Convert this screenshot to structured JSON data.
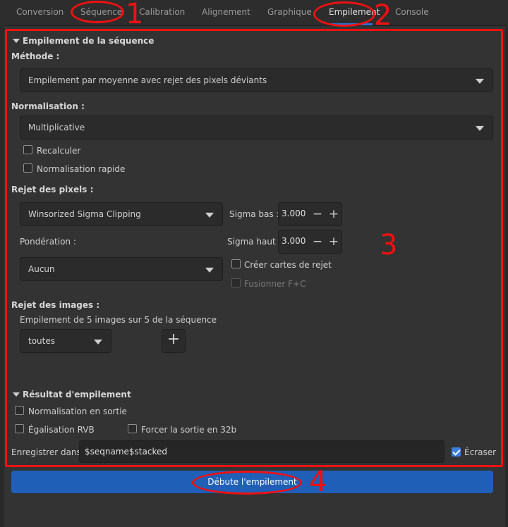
{
  "tabs": [
    {
      "label": "Conversion"
    },
    {
      "label": "Séquence"
    },
    {
      "label": "Calibration"
    },
    {
      "label": "Alignement"
    },
    {
      "label": "Graphique"
    },
    {
      "label": "Empilement"
    },
    {
      "label": "Console"
    }
  ],
  "stacking": {
    "section_title": "Empilement de la séquence",
    "method_label": "Méthode :",
    "method_value": "Empilement par moyenne avec rejet des pixels déviants",
    "normalisation_label": "Normalisation :",
    "normalisation_value": "Multiplicative",
    "recompute_label": "Recalculer",
    "fast_norm_label": "Normalisation rapide",
    "pixel_rejection_label": "Rejet des pixels :",
    "rejection_value": "Winsorized Sigma Clipping",
    "sigma_low_label": "Sigma bas :",
    "sigma_low_value": "3.000",
    "sigma_high_label": "Sigma haut :",
    "sigma_high_value": "3.000",
    "weighting_label": "Pondération :",
    "weighting_value": "Aucun",
    "create_rejmaps_label": "Créer cartes de rejet",
    "merge_label": "Fusionner F+C",
    "image_rejection_label": "Rejet des images :",
    "image_count_text": "Empilement de 5 images sur 5 de la séquence",
    "image_filter_value": "toutes",
    "plus_glyph": "+",
    "minus_glyph": "−"
  },
  "result": {
    "section_title": "Résultat d'empilement",
    "output_norm_label": "Normalisation en sortie",
    "rgb_eq_label": "Égalisation RVB",
    "force32_label": "Forcer la sortie en 32b",
    "save_in_label": "Enregistrer dans :",
    "save_in_value": "$seqname$stacked",
    "overwrite_label": "Écraser",
    "overwrite_checked": true
  },
  "start_button_label": "Débute l'empilement",
  "annotations": {
    "numbers": [
      "1",
      "2",
      "3",
      "4"
    ],
    "color": "#ee1111"
  },
  "colors": {
    "accent": "#1f5fb8",
    "background": "#333333"
  }
}
